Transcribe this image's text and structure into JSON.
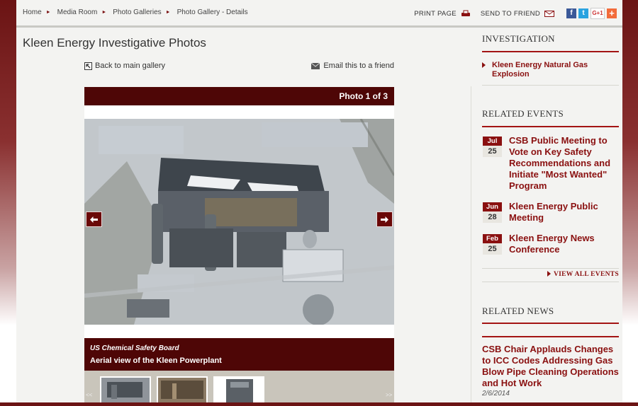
{
  "breadcrumb": [
    "Home",
    "Media Room",
    "Photo Galleries",
    "Photo Gallery - Details"
  ],
  "tools": {
    "print": "PRINT PAGE",
    "send": "SEND TO FRIEND",
    "social": [
      {
        "name": "facebook-icon",
        "glyph": "f",
        "color": "#3b5998"
      },
      {
        "name": "twitter-icon",
        "glyph": "t",
        "color": "#2aa3e0"
      },
      {
        "name": "google-plus-icon",
        "glyph": "G+1",
        "color": "#ffffff"
      },
      {
        "name": "addthis-icon",
        "glyph": "+",
        "color": "#f26b3a"
      }
    ]
  },
  "page_title": "Kleen Energy Investigative Photos",
  "actions": {
    "back": "Back to main gallery",
    "email": "Email this to a friend"
  },
  "gallery": {
    "counter": "Photo 1 of 3",
    "caption_source": "US Chemical Safety Board",
    "caption_text": "Aerial view of the Kleen Powerplant",
    "prev_label": "<<",
    "next_label": ">>"
  },
  "sidebar": {
    "investigation": {
      "heading": "INVESTIGATION",
      "link": "Kleen Energy Natural Gas Explosion"
    },
    "events": {
      "heading": "RELATED EVENTS",
      "items": [
        {
          "month": "Jul",
          "day": "25",
          "title": "CSB Public Meeting to Vote on Key Safety Recommendations and Initiate \"Most Wanted\" Program"
        },
        {
          "month": "Jun",
          "day": "28",
          "title": "Kleen Energy Public Meeting"
        },
        {
          "month": "Feb",
          "day": "25",
          "title": "Kleen Energy News Conference"
        }
      ],
      "view_all": "VIEW ALL EVENTS"
    },
    "news": {
      "heading": "RELATED NEWS",
      "title": "CSB Chair Applauds Changes to ICC Codes Addressing Gas Blow Pipe Cleaning Operations and Hot Work",
      "date": "2/6/2014"
    }
  }
}
